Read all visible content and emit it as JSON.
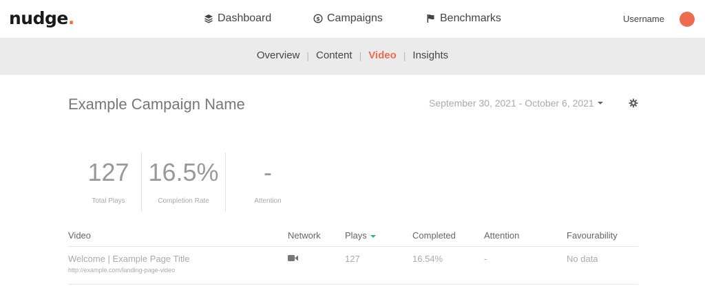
{
  "brand": {
    "logo_text": "nudge",
    "logo_dot": ".",
    "accent": "#ee6c4d"
  },
  "nav": {
    "items": [
      {
        "label": "Dashboard",
        "icon": "layers-icon"
      },
      {
        "label": "Campaigns",
        "icon": "dollar-circle-icon"
      },
      {
        "label": "Benchmarks",
        "icon": "flag-icon"
      }
    ],
    "username": "Username"
  },
  "subnav": {
    "tabs": [
      {
        "label": "Overview",
        "active": false
      },
      {
        "label": "Content",
        "active": false
      },
      {
        "label": "Video",
        "active": true
      },
      {
        "label": "Insights",
        "active": false
      }
    ]
  },
  "header": {
    "campaign_name": "Example Campaign Name",
    "date_range": "September 30, 2021 - October 6, 2021"
  },
  "stats": [
    {
      "value": "127",
      "label": "Total Plays"
    },
    {
      "value": "16.5%",
      "label": "Completion Rate"
    },
    {
      "value": "-",
      "label": "Attention"
    }
  ],
  "table": {
    "columns": [
      "Video",
      "Network",
      "Plays",
      "Completed",
      "Attention",
      "Favourability"
    ],
    "sort_column": "Plays",
    "rows": [
      {
        "title": "Welcome | Example Page Title",
        "url": "http://example.com/landing-page-video",
        "network_icon": "video-camera-icon",
        "plays": "127",
        "completed": "16.54%",
        "attention": "-",
        "favourability": "No data"
      }
    ]
  }
}
